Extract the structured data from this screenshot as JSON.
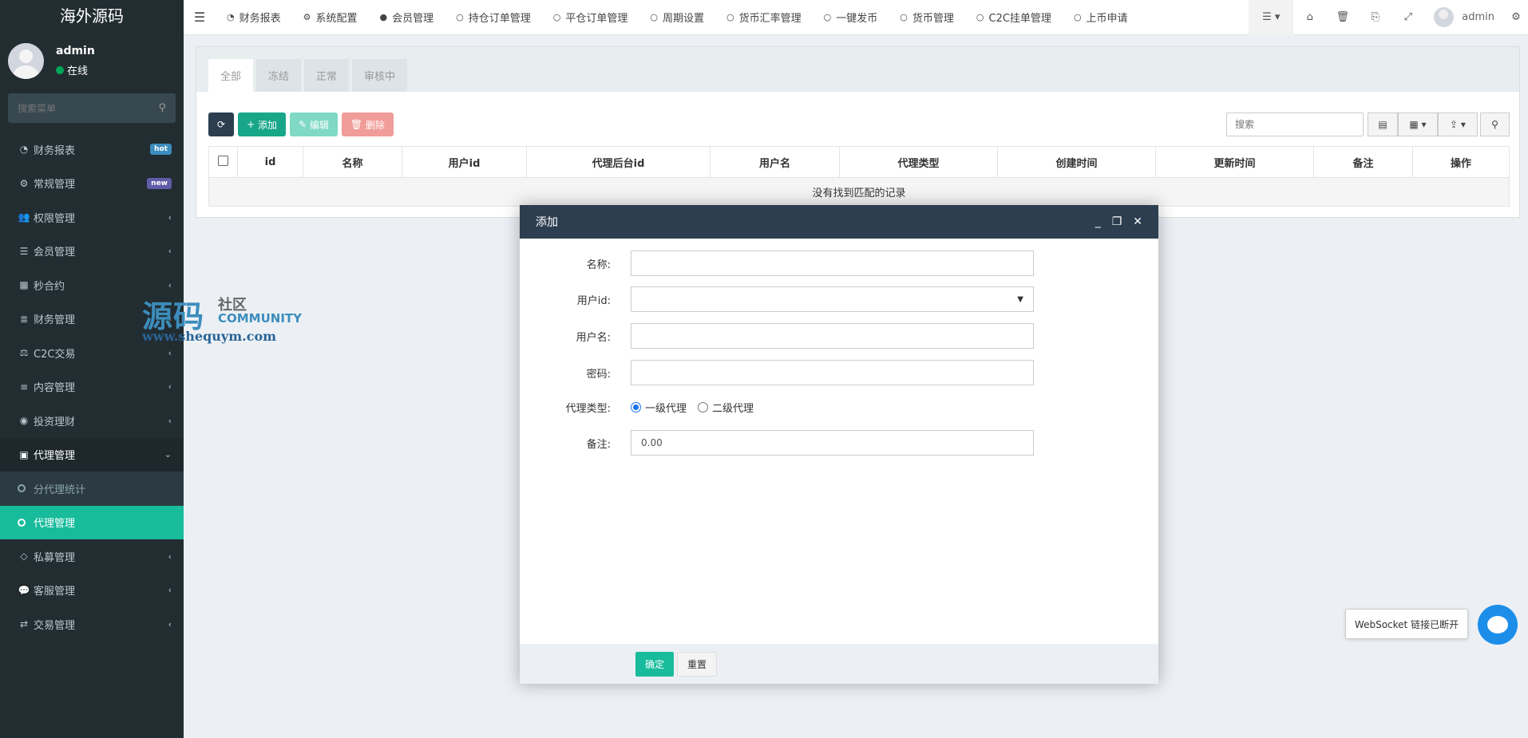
{
  "app": {
    "logo": "海外源码"
  },
  "user": {
    "name": "admin",
    "status": "在线"
  },
  "sidebar": {
    "search_placeholder": "搜索菜单",
    "items": [
      {
        "label": "财务报表",
        "icon": "dashboard-icon",
        "badge": "hot",
        "badge_color": "#3c8dbc"
      },
      {
        "label": "常规管理",
        "icon": "cogs-icon",
        "badge": "new",
        "badge_color": "#605ca8"
      },
      {
        "label": "权限管理",
        "icon": "group-icon",
        "arrow": "‹"
      },
      {
        "label": "会员管理",
        "icon": "list-icon",
        "arrow": "‹"
      },
      {
        "label": "秒合约",
        "icon": "calendar-icon",
        "arrow": "‹"
      },
      {
        "label": "财务管理",
        "icon": "database-icon",
        "arrow": "‹"
      },
      {
        "label": "C2C交易",
        "icon": "balance-scale-icon",
        "arrow": "‹"
      },
      {
        "label": "内容管理",
        "icon": "align-left-icon",
        "arrow": "‹"
      },
      {
        "label": "投资理财",
        "icon": "compass-icon",
        "arrow": "‹"
      },
      {
        "label": "代理管理",
        "icon": "briefcase-icon",
        "arrow": "⌄"
      },
      {
        "label": "分代理统计",
        "icon": "circle-icon"
      },
      {
        "label": "代理管理",
        "icon": "circle-icon"
      },
      {
        "label": "私募管理",
        "icon": "diamond-icon",
        "arrow": "‹"
      },
      {
        "label": "客服管理",
        "icon": "comment-icon",
        "arrow": "‹"
      },
      {
        "label": "交易管理",
        "icon": "handshake-icon",
        "arrow": "‹"
      }
    ]
  },
  "topbar": {
    "tabs": [
      {
        "label": "财务报表",
        "icon": "dashboard-icon"
      },
      {
        "label": "系统配置",
        "icon": "cog-icon"
      },
      {
        "label": "会员管理",
        "icon": "user-icon"
      },
      {
        "label": "持仓订单管理",
        "icon": "circle-icon"
      },
      {
        "label": "平仓订单管理",
        "icon": "circle-icon"
      },
      {
        "label": "周期设置",
        "icon": "circle-icon"
      },
      {
        "label": "货币汇率管理",
        "icon": "circle-icon"
      },
      {
        "label": "一键发币",
        "icon": "circle-icon"
      },
      {
        "label": "货币管理",
        "icon": "circle-icon"
      },
      {
        "label": "C2C挂单管理",
        "icon": "circle-icon"
      },
      {
        "label": "上币申请",
        "icon": "circle-icon"
      }
    ],
    "user": "admin"
  },
  "content": {
    "tabs": [
      "全部",
      "冻结",
      "正常",
      "审核中"
    ],
    "toolbar": {
      "refresh": "⟳",
      "add": "添加",
      "edit": "编辑",
      "delete": "删除"
    },
    "search_placeholder": "搜索",
    "columns": [
      "id",
      "名称",
      "用户id",
      "代理后台id",
      "用户名",
      "代理类型",
      "创建时间",
      "更新时间",
      "备注",
      "操作"
    ],
    "empty_text": "没有找到匹配的记录"
  },
  "watermark": {
    "big": "源码",
    "cn": "社区",
    "en": "COMMUNITY",
    "url": "www.shequym.com"
  },
  "dialog": {
    "title": "添加",
    "fields": {
      "name_label": "名称:",
      "userid_label": "用户id:",
      "username_label": "用户名:",
      "password_label": "密码:",
      "type_label": "代理类型:",
      "type_opt1": "一级代理",
      "type_opt2": "二级代理",
      "remark_label": "备注:",
      "remark_value": "0.00"
    },
    "ok": "确定",
    "reset": "重置"
  },
  "websocket": {
    "tip": "WebSocket 链接已断开"
  }
}
